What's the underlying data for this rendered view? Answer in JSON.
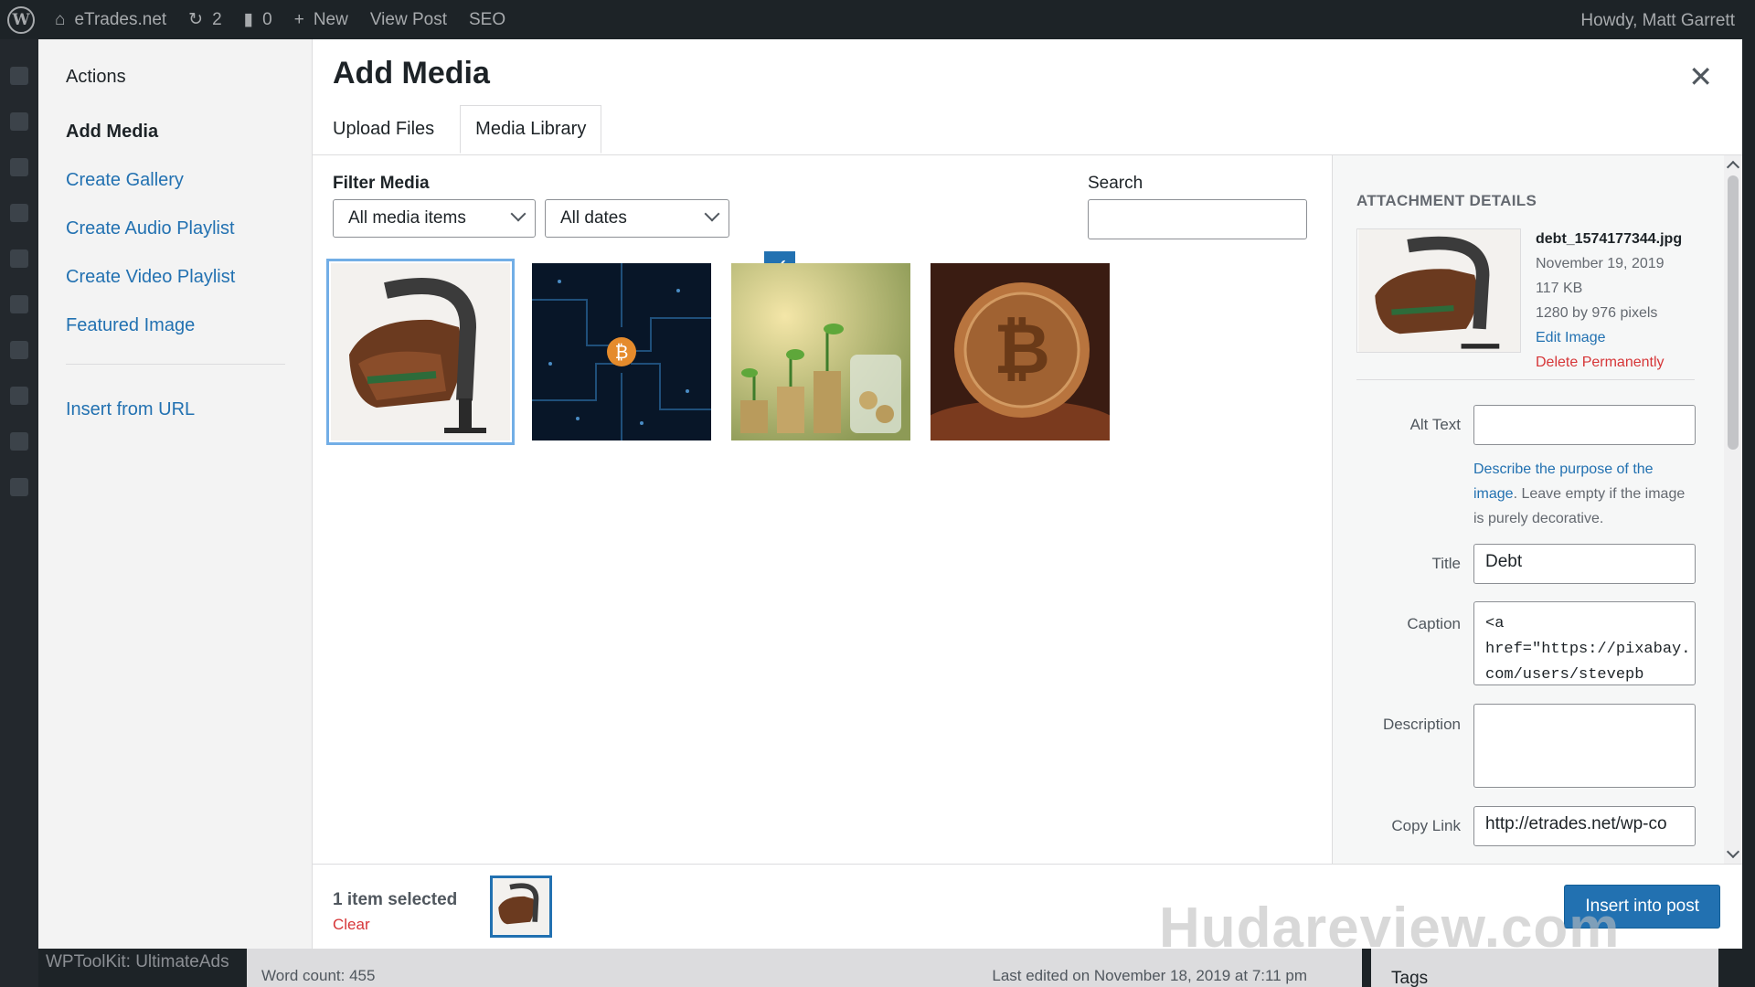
{
  "adminbar": {
    "site_name": "eTrades.net",
    "updates_count": "2",
    "comments_count": "0",
    "new_label": "New",
    "view_post": "View Post",
    "seo": "SEO",
    "greeting": "Howdy, Matt Garrett"
  },
  "sidebar": {
    "heading": "Actions",
    "items": [
      {
        "label": "Add Media",
        "active": true
      },
      {
        "label": "Create Gallery"
      },
      {
        "label": "Create Audio Playlist"
      },
      {
        "label": "Create Video Playlist"
      },
      {
        "label": "Featured Image"
      },
      {
        "label": "Insert from URL"
      }
    ]
  },
  "frame": {
    "title": "Add Media",
    "tabs": [
      {
        "label": "Upload Files"
      },
      {
        "label": "Media Library",
        "active": true
      }
    ]
  },
  "filters": {
    "label": "Filter Media",
    "type_selected": "All media items",
    "date_selected": "All dates",
    "search_label": "Search",
    "search_value": ""
  },
  "media_items": [
    {
      "name": "debt-clamp-wallet",
      "selected": true
    },
    {
      "name": "bitcoin-circuit"
    },
    {
      "name": "coin-stacks-plants"
    },
    {
      "name": "bitcoin-coin"
    }
  ],
  "details": {
    "heading": "ATTACHMENT DETAILS",
    "filename": "debt_1574177344.jpg",
    "date": "November 19, 2019",
    "size": "117 KB",
    "dimensions": "1280 by 976 pixels",
    "edit_link": "Edit Image",
    "delete_link": "Delete Permanently",
    "alt_label": "Alt Text",
    "alt_value": "",
    "help_link": "Describe the purpose of the image",
    "help_rest": ". Leave empty if the image is purely decorative.",
    "title_label": "Title",
    "title_value": "Debt",
    "caption_label": "Caption",
    "caption_value": "<a\nhref=\"https://pixabay.\ncom/users/stevepb",
    "description_label": "Description",
    "description_value": "",
    "copy_label": "Copy Link",
    "copy_value": "http://etrades.net/wp-co"
  },
  "toolbar": {
    "count": "1 item selected",
    "clear": "Clear",
    "insert": "Insert into post"
  },
  "editor": {
    "word_count": "Word count: 455",
    "last_edited": "Last edited on November 18, 2019 at 7:11 pm",
    "tags": "Tags",
    "wptoolkit": "WPToolKit: UltimateAds"
  },
  "watermark": "Hudareview.com",
  "colors": {
    "accent": "#2271b1",
    "danger": "#d63638",
    "adminbar": "#1d2327"
  }
}
